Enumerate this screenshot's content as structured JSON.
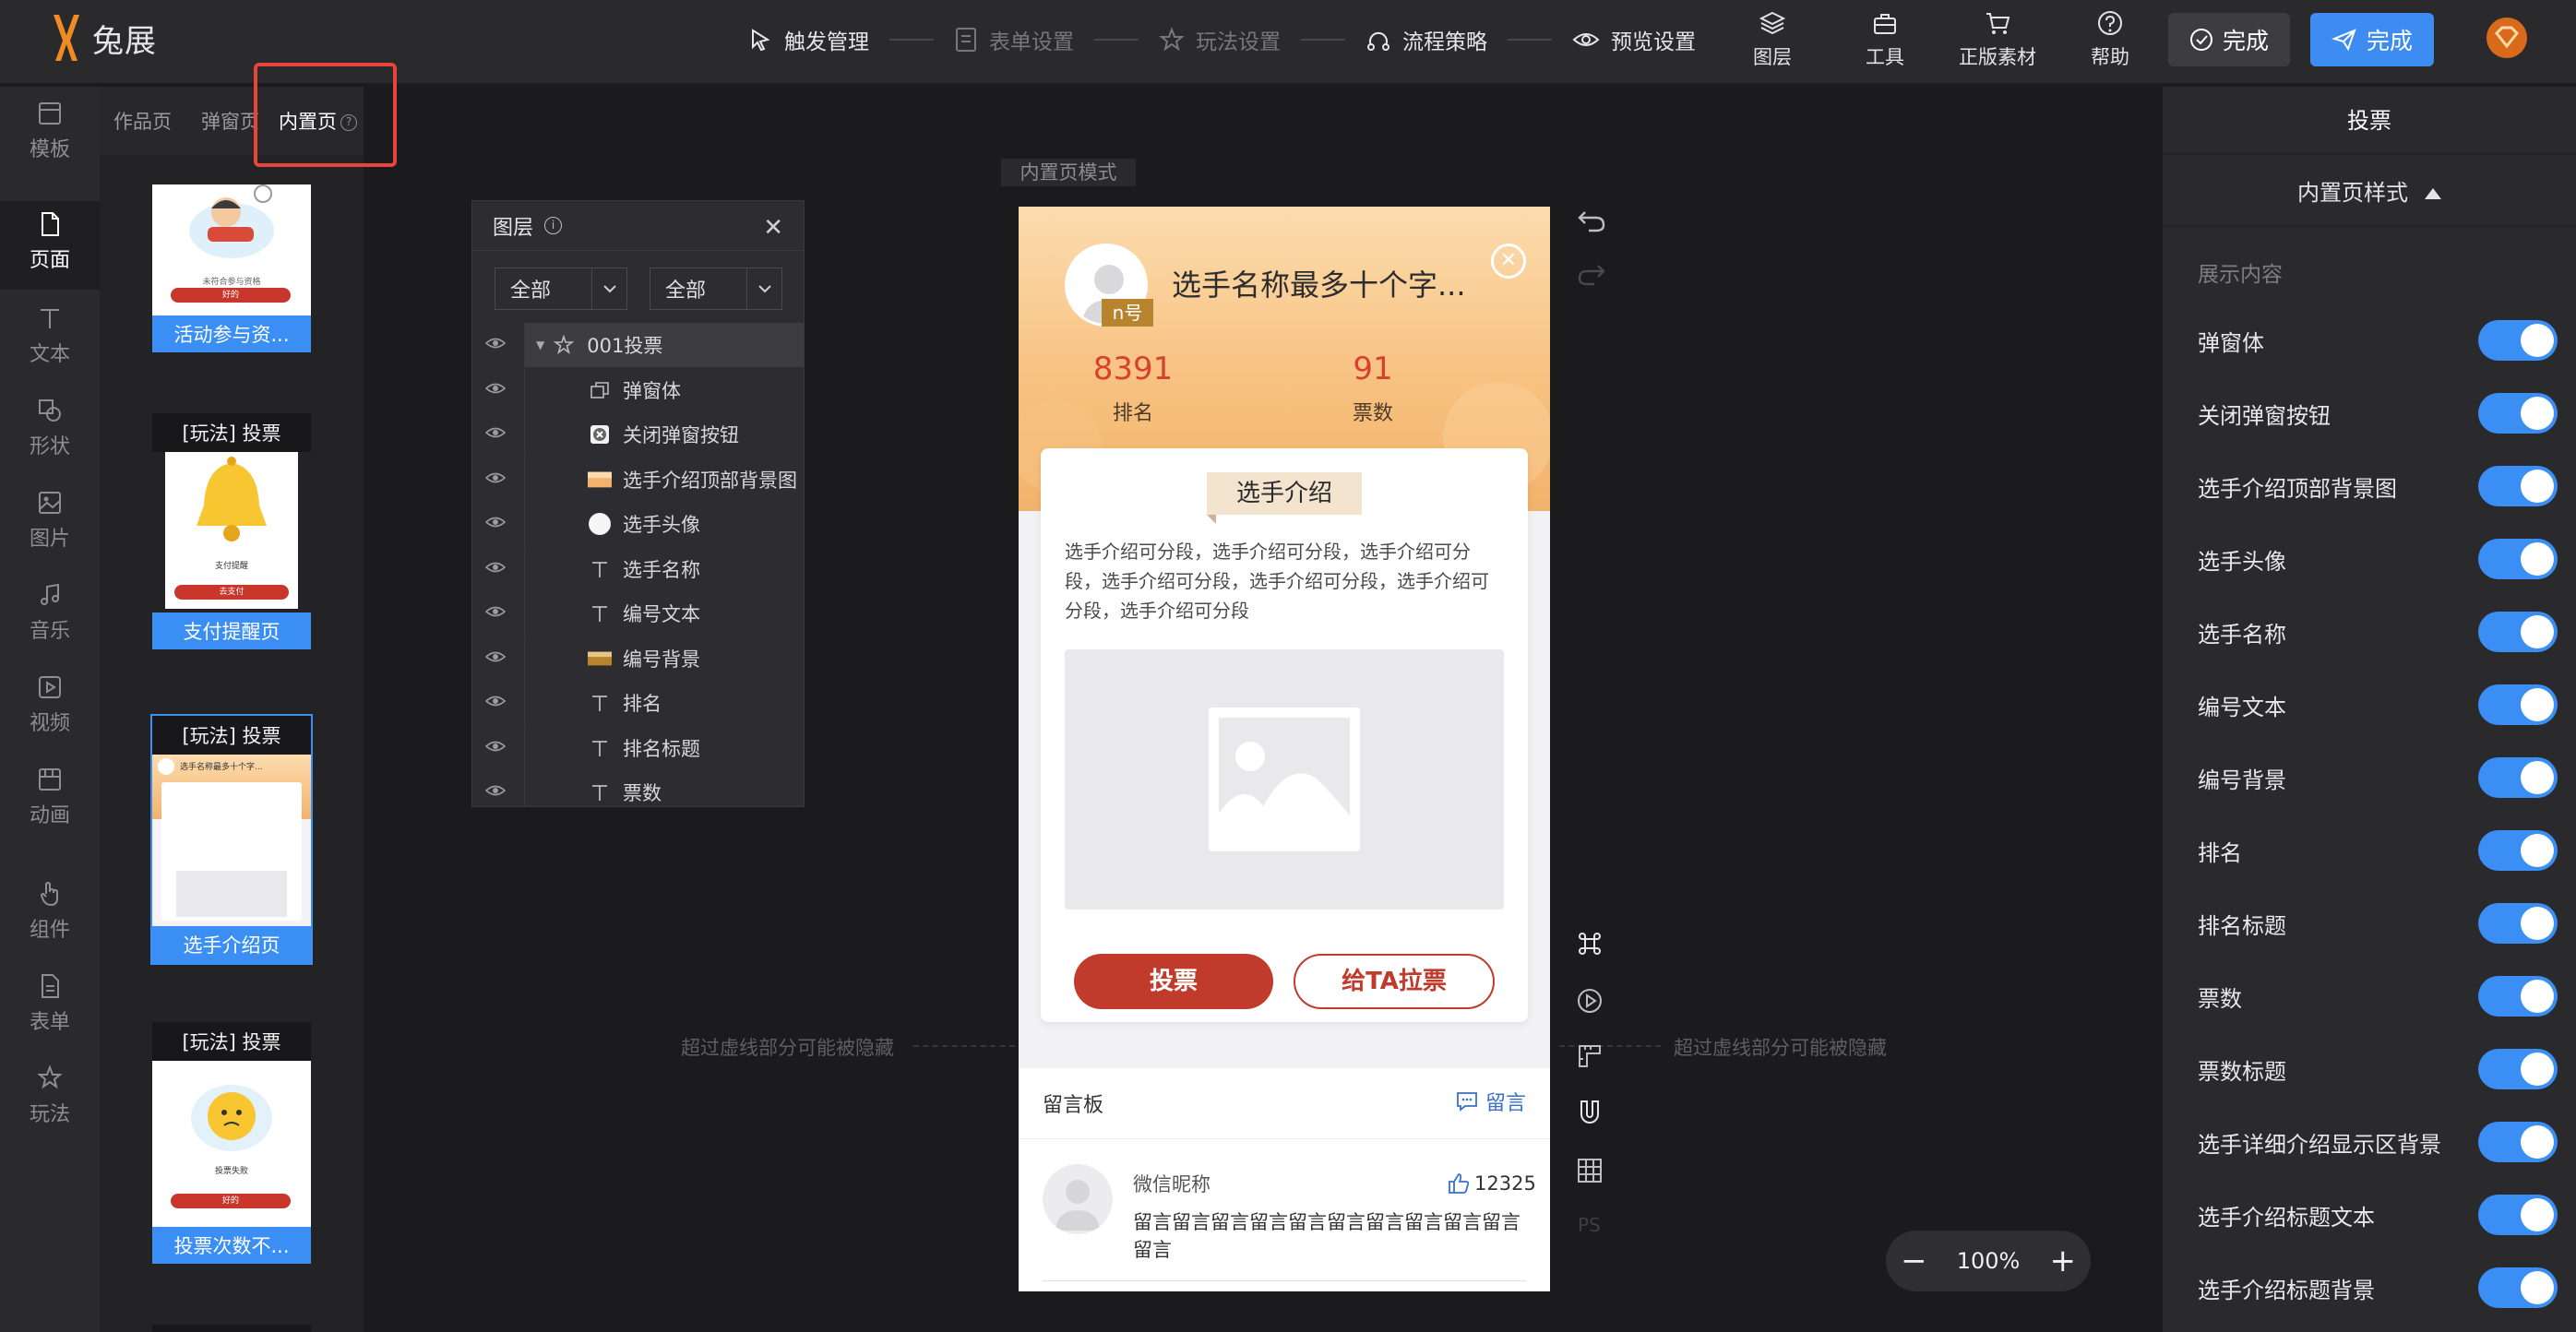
{
  "app": {
    "logo_text": "兔展"
  },
  "steps": [
    {
      "label": "触发管理",
      "icon": "cursor-click-icon",
      "active": true
    },
    {
      "label": "表单设置",
      "icon": "form-icon",
      "active": false
    },
    {
      "label": "玩法设置",
      "icon": "star-badge-icon",
      "active": false
    },
    {
      "label": "流程策略",
      "icon": "flow-icon",
      "active": true
    },
    {
      "label": "预览设置",
      "icon": "eye-icon",
      "active": true
    }
  ],
  "tools": [
    {
      "label": "图层",
      "icon": "layers-icon"
    },
    {
      "label": "工具",
      "icon": "toolbox-icon"
    },
    {
      "label": "正版素材",
      "icon": "cart-icon"
    },
    {
      "label": "帮助",
      "icon": "help-icon"
    }
  ],
  "buttons": {
    "done_gray": "完成",
    "done_blue": "完成"
  },
  "leftbar": [
    {
      "label": "模板",
      "icon": "template-icon"
    },
    {
      "label": "页面",
      "icon": "page-icon",
      "active": true
    },
    {
      "label": "文本",
      "icon": "text-icon"
    },
    {
      "label": "形状",
      "icon": "shape-icon"
    },
    {
      "label": "图片",
      "icon": "image-icon"
    },
    {
      "label": "音乐",
      "icon": "music-icon"
    },
    {
      "label": "视频",
      "icon": "video-icon"
    },
    {
      "label": "动画",
      "icon": "animation-icon"
    },
    {
      "label": "组件",
      "icon": "hand-pointer-icon"
    },
    {
      "label": "表单",
      "icon": "form-doc-icon"
    },
    {
      "label": "玩法",
      "icon": "play-star-icon"
    }
  ],
  "page_tabs": [
    "作品页",
    "弹窗页",
    "内置页"
  ],
  "thumbs": [
    {
      "head": "",
      "label": "活动参与资...",
      "mini_text": "未符合参与资格",
      "mini_btn": "好的"
    },
    {
      "head": "[玩法] 投票",
      "label": "支付提醒页",
      "mini_text": "支付提醒",
      "mini_btn": "去支付"
    },
    {
      "head": "[玩法] 投票",
      "label": "选手介绍页",
      "mini_text": "选手名称最多十个字...",
      "mini_btn": ""
    },
    {
      "head": "[玩法] 投票",
      "label": "投票次数不...",
      "mini_text": "投票失败",
      "mini_btn": "好的"
    }
  ],
  "canvas": {
    "mode_tag": "内置页模式",
    "hint_left": "超过虚线部分可能被隐藏",
    "hint_right": "超过虚线部分可能被隐藏",
    "zoom": "100%"
  },
  "layers": {
    "title": "图层",
    "filter1": "全部",
    "filter2": "全部",
    "items": [
      {
        "label": "001投票",
        "icon": "group-icon"
      },
      {
        "label": "弹窗体",
        "icon": "popup-icon"
      },
      {
        "label": "关闭弹窗按钮",
        "icon": "close-box-icon"
      },
      {
        "label": "选手介绍顶部背景图",
        "icon": "image-thumb-icon"
      },
      {
        "label": "选手头像",
        "icon": "circle-thumb-icon"
      },
      {
        "label": "选手名称",
        "icon": "text-icon"
      },
      {
        "label": "编号文本",
        "icon": "text-icon"
      },
      {
        "label": "编号背景",
        "icon": "image-thumb-icon"
      },
      {
        "label": "排名",
        "icon": "text-icon"
      },
      {
        "label": "排名标题",
        "icon": "text-icon"
      },
      {
        "label": "票数",
        "icon": "text-icon"
      }
    ]
  },
  "phone": {
    "num": "n号",
    "name": "选手名称最多十个字...",
    "rank_value": "8391",
    "rank_label": "排名",
    "votes_value": "91",
    "votes_label": "票数",
    "intro_title": "选手介绍",
    "intro_text": "选手介绍可分段，选手介绍可分段，选手介绍可分段，选手介绍可分段，选手介绍可分段，选手介绍可分段，选手介绍可分段",
    "btn_vote": "投票",
    "btn_pull": "给TA拉票",
    "msg_title": "留言板",
    "msg_link": "留言",
    "msg_nick": "微信昵称",
    "msg_likes": "12325",
    "msg_body": "留言留言留言留言留言留言留言留言留言留言留言"
  },
  "rpanel": {
    "title": "投票",
    "subtitle": "内置页样式",
    "section": "展示内容",
    "toggles": [
      {
        "label": "弹窗体",
        "on": true
      },
      {
        "label": "关闭弹窗按钮",
        "on": true
      },
      {
        "label": "选手介绍顶部背景图",
        "on": true
      },
      {
        "label": "选手头像",
        "on": true
      },
      {
        "label": "选手名称",
        "on": true
      },
      {
        "label": "编号文本",
        "on": true
      },
      {
        "label": "编号背景",
        "on": true
      },
      {
        "label": "排名",
        "on": true
      },
      {
        "label": "排名标题",
        "on": true
      },
      {
        "label": "票数",
        "on": true
      },
      {
        "label": "票数标题",
        "on": true
      },
      {
        "label": "选手详细介绍显示区背景",
        "on": true
      },
      {
        "label": "选手介绍标题文本",
        "on": true
      },
      {
        "label": "选手介绍标题背景",
        "on": true
      }
    ]
  },
  "colors": {
    "accent": "#3a8ef4",
    "danger": "#c13b2c",
    "highlight": "#e6453a",
    "logo": "#f08a24"
  }
}
